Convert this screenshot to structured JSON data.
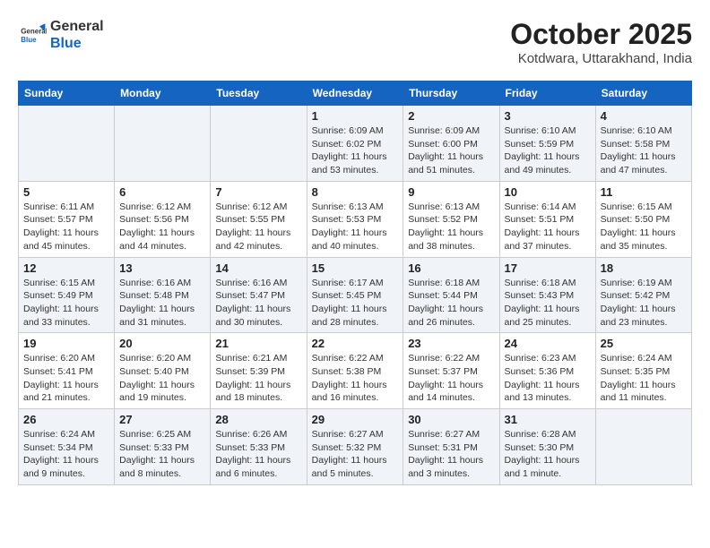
{
  "header": {
    "logo_general": "General",
    "logo_blue": "Blue",
    "month": "October 2025",
    "location": "Kotdwara, Uttarakhand, India"
  },
  "weekdays": [
    "Sunday",
    "Monday",
    "Tuesday",
    "Wednesday",
    "Thursday",
    "Friday",
    "Saturday"
  ],
  "weeks": [
    [
      {
        "day": "",
        "info": ""
      },
      {
        "day": "",
        "info": ""
      },
      {
        "day": "",
        "info": ""
      },
      {
        "day": "1",
        "info": "Sunrise: 6:09 AM\nSunset: 6:02 PM\nDaylight: 11 hours and 53 minutes."
      },
      {
        "day": "2",
        "info": "Sunrise: 6:09 AM\nSunset: 6:00 PM\nDaylight: 11 hours and 51 minutes."
      },
      {
        "day": "3",
        "info": "Sunrise: 6:10 AM\nSunset: 5:59 PM\nDaylight: 11 hours and 49 minutes."
      },
      {
        "day": "4",
        "info": "Sunrise: 6:10 AM\nSunset: 5:58 PM\nDaylight: 11 hours and 47 minutes."
      }
    ],
    [
      {
        "day": "5",
        "info": "Sunrise: 6:11 AM\nSunset: 5:57 PM\nDaylight: 11 hours and 45 minutes."
      },
      {
        "day": "6",
        "info": "Sunrise: 6:12 AM\nSunset: 5:56 PM\nDaylight: 11 hours and 44 minutes."
      },
      {
        "day": "7",
        "info": "Sunrise: 6:12 AM\nSunset: 5:55 PM\nDaylight: 11 hours and 42 minutes."
      },
      {
        "day": "8",
        "info": "Sunrise: 6:13 AM\nSunset: 5:53 PM\nDaylight: 11 hours and 40 minutes."
      },
      {
        "day": "9",
        "info": "Sunrise: 6:13 AM\nSunset: 5:52 PM\nDaylight: 11 hours and 38 minutes."
      },
      {
        "day": "10",
        "info": "Sunrise: 6:14 AM\nSunset: 5:51 PM\nDaylight: 11 hours and 37 minutes."
      },
      {
        "day": "11",
        "info": "Sunrise: 6:15 AM\nSunset: 5:50 PM\nDaylight: 11 hours and 35 minutes."
      }
    ],
    [
      {
        "day": "12",
        "info": "Sunrise: 6:15 AM\nSunset: 5:49 PM\nDaylight: 11 hours and 33 minutes."
      },
      {
        "day": "13",
        "info": "Sunrise: 6:16 AM\nSunset: 5:48 PM\nDaylight: 11 hours and 31 minutes."
      },
      {
        "day": "14",
        "info": "Sunrise: 6:16 AM\nSunset: 5:47 PM\nDaylight: 11 hours and 30 minutes."
      },
      {
        "day": "15",
        "info": "Sunrise: 6:17 AM\nSunset: 5:45 PM\nDaylight: 11 hours and 28 minutes."
      },
      {
        "day": "16",
        "info": "Sunrise: 6:18 AM\nSunset: 5:44 PM\nDaylight: 11 hours and 26 minutes."
      },
      {
        "day": "17",
        "info": "Sunrise: 6:18 AM\nSunset: 5:43 PM\nDaylight: 11 hours and 25 minutes."
      },
      {
        "day": "18",
        "info": "Sunrise: 6:19 AM\nSunset: 5:42 PM\nDaylight: 11 hours and 23 minutes."
      }
    ],
    [
      {
        "day": "19",
        "info": "Sunrise: 6:20 AM\nSunset: 5:41 PM\nDaylight: 11 hours and 21 minutes."
      },
      {
        "day": "20",
        "info": "Sunrise: 6:20 AM\nSunset: 5:40 PM\nDaylight: 11 hours and 19 minutes."
      },
      {
        "day": "21",
        "info": "Sunrise: 6:21 AM\nSunset: 5:39 PM\nDaylight: 11 hours and 18 minutes."
      },
      {
        "day": "22",
        "info": "Sunrise: 6:22 AM\nSunset: 5:38 PM\nDaylight: 11 hours and 16 minutes."
      },
      {
        "day": "23",
        "info": "Sunrise: 6:22 AM\nSunset: 5:37 PM\nDaylight: 11 hours and 14 minutes."
      },
      {
        "day": "24",
        "info": "Sunrise: 6:23 AM\nSunset: 5:36 PM\nDaylight: 11 hours and 13 minutes."
      },
      {
        "day": "25",
        "info": "Sunrise: 6:24 AM\nSunset: 5:35 PM\nDaylight: 11 hours and 11 minutes."
      }
    ],
    [
      {
        "day": "26",
        "info": "Sunrise: 6:24 AM\nSunset: 5:34 PM\nDaylight: 11 hours and 9 minutes."
      },
      {
        "day": "27",
        "info": "Sunrise: 6:25 AM\nSunset: 5:33 PM\nDaylight: 11 hours and 8 minutes."
      },
      {
        "day": "28",
        "info": "Sunrise: 6:26 AM\nSunset: 5:33 PM\nDaylight: 11 hours and 6 minutes."
      },
      {
        "day": "29",
        "info": "Sunrise: 6:27 AM\nSunset: 5:32 PM\nDaylight: 11 hours and 5 minutes."
      },
      {
        "day": "30",
        "info": "Sunrise: 6:27 AM\nSunset: 5:31 PM\nDaylight: 11 hours and 3 minutes."
      },
      {
        "day": "31",
        "info": "Sunrise: 6:28 AM\nSunset: 5:30 PM\nDaylight: 11 hours and 1 minute."
      },
      {
        "day": "",
        "info": ""
      }
    ]
  ]
}
